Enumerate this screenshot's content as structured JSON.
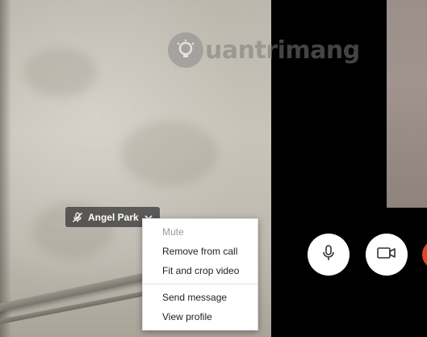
{
  "watermark": {
    "text": "uantrimang",
    "icon": "lightbulb-icon"
  },
  "participant": {
    "name": "Angel Park",
    "status_icon": "microphone-muted-icon",
    "menu_icon": "chevron-down-icon"
  },
  "context_menu": {
    "items": [
      {
        "label": "Mute",
        "enabled": false
      },
      {
        "label": "Remove from call",
        "enabled": true
      },
      {
        "label": "Fit and crop video",
        "enabled": true
      },
      {
        "label": "Send message",
        "enabled": true
      },
      {
        "label": "View profile",
        "enabled": true
      }
    ]
  },
  "controls": {
    "microphone": "microphone-icon",
    "video": "video-camera-icon",
    "end_call": "end-call-icon"
  },
  "colors": {
    "end_call": "#e2432a",
    "menu_bg": "#ffffff",
    "name_tag_bg": "#3c3c3c"
  }
}
